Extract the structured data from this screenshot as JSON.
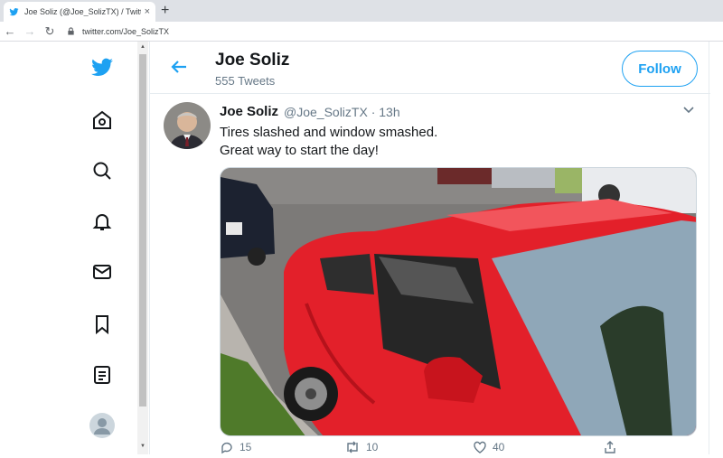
{
  "browser": {
    "tab_title": "Joe Soliz (@Joe_SolizTX) / Twitter",
    "tab_close": "×",
    "new_tab": "+",
    "url": "twitter.com/Joe_SolizTX",
    "nav": {
      "back": "←",
      "forward": "→",
      "reload": "↻"
    }
  },
  "sidebar": {
    "icons": [
      "twitter-logo",
      "home",
      "explore",
      "notifications",
      "messages",
      "bookmarks",
      "lists",
      "profile"
    ]
  },
  "header": {
    "name": "Joe Soliz",
    "tweet_count": "555 Tweets",
    "follow_label": "Follow"
  },
  "tweet": {
    "author_name": "Joe Soliz",
    "author_meta": "@Joe_SolizTX · 13h",
    "text_line1": "Tires slashed and window smashed.",
    "text_line2": "Great way to start the day!",
    "reply_count": "15",
    "retweet_count": "10",
    "like_count": "40"
  },
  "colors": {
    "brand": "#1da1f2",
    "text": "#14171a",
    "muted": "#657786"
  }
}
